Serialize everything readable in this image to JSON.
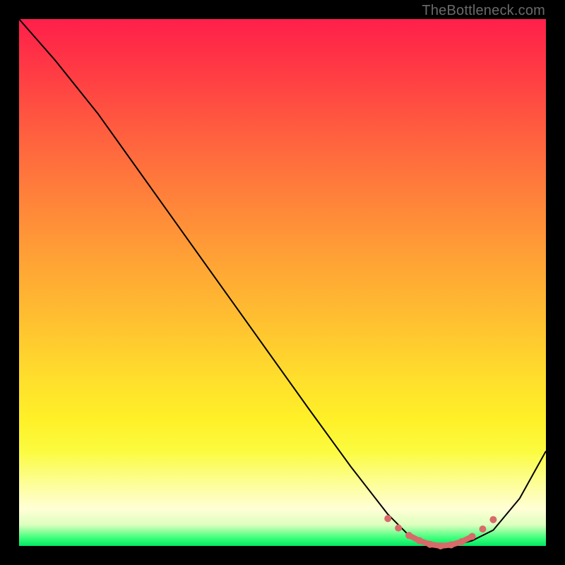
{
  "watermark": "TheBottleneck.com",
  "chart_data": {
    "type": "line",
    "title": "",
    "xlabel": "",
    "ylabel": "",
    "xlim": [
      0,
      100
    ],
    "ylim": [
      0,
      100
    ],
    "series": [
      {
        "name": "bottleneck-curve",
        "x": [
          0,
          7,
          15,
          25,
          35,
          45,
          55,
          63,
          70,
          74,
          78,
          82,
          86,
          90,
          95,
          100
        ],
        "y": [
          100,
          92,
          82,
          68,
          54,
          40,
          26,
          15,
          6,
          2,
          0,
          0,
          1,
          3,
          9,
          18
        ],
        "color": "#000000",
        "width": 2
      },
      {
        "name": "optimal-band",
        "x": [
          70,
          72,
          74,
          76,
          78,
          80,
          82,
          84,
          86,
          88,
          90
        ],
        "y": [
          5.2,
          3.4,
          2.0,
          1.0,
          0.3,
          0.0,
          0.2,
          0.8,
          1.8,
          3.2,
          5.0
        ],
        "color": "#d86a6a",
        "width": 8,
        "style": "dot-dash"
      }
    ],
    "note": "Axes have no visible tick labels; x and y are read as 0–100 percent of plot area. Optimal band sits at the valley floor between roughly x=70 and x=90."
  }
}
